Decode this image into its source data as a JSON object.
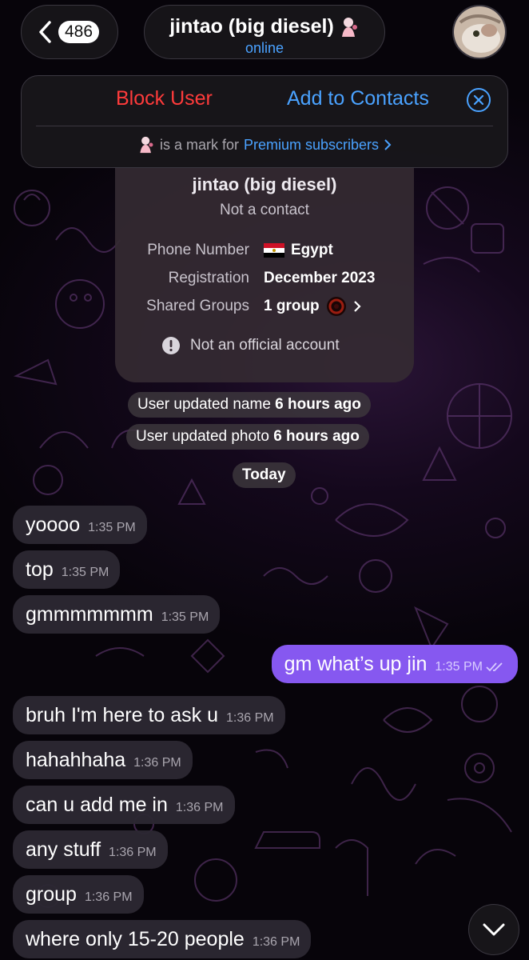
{
  "header": {
    "unread_count": "486",
    "chat_name": "jintao (big diesel)",
    "status": "online"
  },
  "actions": {
    "block_label": "Block User",
    "add_label": "Add to Contacts",
    "premium_prefix": "is a mark for",
    "premium_link": "Premium subscribers"
  },
  "info_card": {
    "name": "jintao (big diesel)",
    "subtitle": "Not a contact",
    "rows": [
      {
        "label": "Phone Number",
        "value": "Egypt"
      },
      {
        "label": "Registration",
        "value": "December 2023"
      },
      {
        "label": "Shared Groups",
        "value": "1 group"
      }
    ],
    "notice": "Not an official account"
  },
  "service_messages": {
    "name_update_text": "User updated name",
    "name_update_time": "6 hours ago",
    "photo_update_text": "User updated photo",
    "photo_update_time": "6 hours ago",
    "date_divider": "Today"
  },
  "messages": [
    {
      "direction": "in",
      "text": "yoooo",
      "time": "1:35 PM"
    },
    {
      "direction": "in",
      "text": "top",
      "time": "1:35 PM"
    },
    {
      "direction": "in",
      "text": "gmmmmmmm",
      "time": "1:35 PM"
    },
    {
      "direction": "out",
      "text": "gm what’s up jin",
      "time": "1:35 PM"
    },
    {
      "direction": "in",
      "text": "bruh I'm here to ask u",
      "time": "1:36 PM"
    },
    {
      "direction": "in",
      "text": "hahahhaha",
      "time": "1:36 PM"
    },
    {
      "direction": "in",
      "text": "can u add me in",
      "time": "1:36 PM"
    },
    {
      "direction": "in",
      "text": "any stuff",
      "time": "1:36 PM"
    },
    {
      "direction": "in",
      "text": "group",
      "time": "1:36 PM"
    },
    {
      "direction": "in",
      "text": "where only 15-20 people",
      "time": "1:36 PM"
    }
  ],
  "colors": {
    "accent_blue": "#4aa2ff",
    "danger_red": "#ff3b3b",
    "outgoing_bubble": "#8658f0",
    "incoming_bubble": "#2c2832"
  },
  "icons": [
    "back-chevron-icon",
    "close-circle-icon",
    "premium-emoji-status-icon",
    "egypt-flag-icon",
    "group-avatar-icon",
    "chevron-right-icon",
    "info-circle-icon",
    "read-double-check-icon",
    "chevron-down-icon"
  ]
}
